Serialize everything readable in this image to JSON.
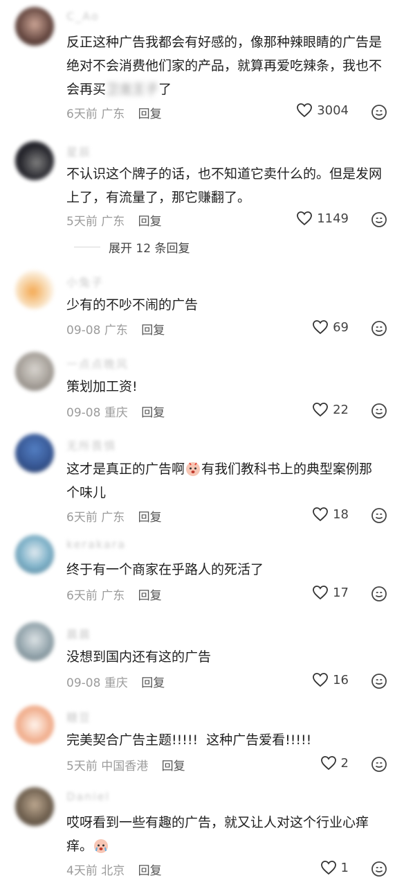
{
  "comments": [
    {
      "username": "C_Ao",
      "text_a": "反正这种广告我都会有好感的，像那种辣眼睛的广告是绝对不会消费他们家的产品，就算再爱吃辣条，我也不会再买",
      "blur": "卫龙王子",
      "text_b": "了",
      "time": "6天前",
      "location": "广东",
      "reply": "回复",
      "likes": "3004",
      "avatar_color": "#5a3b34"
    },
    {
      "username": "星辰",
      "text": "不认识这个牌子的话，也不知道它卖什么的。但是发网上了，有流量了，那它赚翻了。",
      "time": "5天前",
      "location": "广东",
      "reply": "回复",
      "likes": "1149",
      "avatar_color": "#1b1b22"
    },
    {
      "username": "小兔子",
      "text": "少有的不吵不闹的广告",
      "time": "09-08",
      "location": "广东",
      "reply": "回复",
      "likes": "69",
      "avatar_color": "#f0b36a"
    },
    {
      "username": "一点点晚风",
      "text": "策划加工资!",
      "time": "09-08",
      "location": "重庆",
      "reply": "回复",
      "likes": "22",
      "avatar_color": "#a7a19a"
    },
    {
      "username": "无所畏惧",
      "text_a": "这才是真正的广告啊",
      "text_b": "有我们教科书上的典型案例那个味儿",
      "time": "6天前",
      "location": "广东",
      "reply": "回复",
      "likes": "18",
      "avatar_color": "#2d4f8f"
    },
    {
      "username": "kerakara",
      "text": "终于有一个商家在乎路人的死活了",
      "time": "6天前",
      "location": "广东",
      "reply": "回复",
      "likes": "17",
      "avatar_color": "#7bb0c8"
    },
    {
      "username": "晨晨",
      "text": "没想到国内还有这的广告",
      "time": "09-08",
      "location": "重庆",
      "reply": "回复",
      "likes": "16",
      "avatar_color": "#8ea0a8"
    },
    {
      "username": "糖豆",
      "text": "完美契合广告主题!!!!!  这种广告爱看!!!!!",
      "time": "5天前",
      "location": "中国香港",
      "reply": "回复",
      "likes": "2",
      "avatar_color": "#f2b08f"
    },
    {
      "username": "Daniel",
      "text_a": "哎呀看到一些有趣的广告，就又让人对这个行业心痒痒。",
      "time": "4天前",
      "location": "北京",
      "reply": "回复",
      "likes": "1",
      "avatar_color": "#6a5a48"
    }
  ],
  "expand_label": "展开 12 条回复",
  "icons": {
    "like": "heart-outline-icon",
    "emoji": "emoji-face-icon"
  }
}
